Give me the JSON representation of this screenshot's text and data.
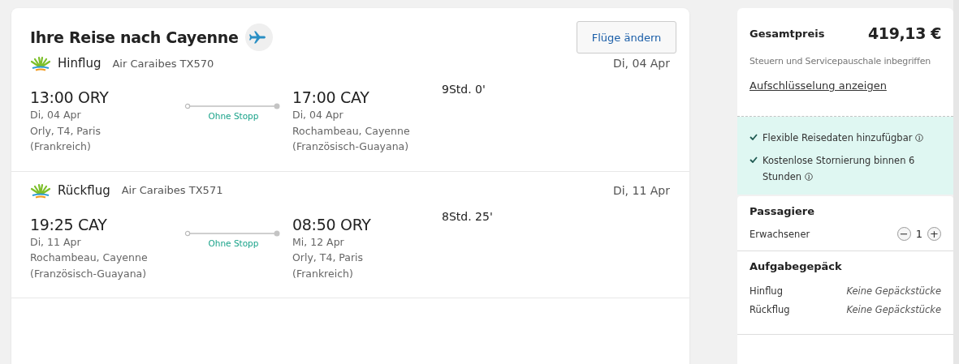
{
  "trip": {
    "title": "Ihre Reise nach Cayenne",
    "change_button": "Flüge ändern",
    "legs": [
      {
        "label": "Hinflug",
        "flight": "Air Caraibes TX570",
        "date": "Di, 04 Apr",
        "stops": "Ohne Stopp",
        "duration": "9Std. 0'",
        "departure": {
          "time": "13:00 ORY",
          "date": "Di, 04 Apr",
          "airport": "Orly, T4, Paris",
          "country": "(Frankreich)"
        },
        "arrival": {
          "time": "17:00 CAY",
          "date": "Di, 04 Apr",
          "airport": "Rochambeau, Cayenne",
          "country": "(Französisch-Guayana)"
        }
      },
      {
        "label": "Rückflug",
        "flight": "Air Caraibes TX571",
        "date": "Di, 11 Apr",
        "stops": "Ohne Stopp",
        "duration": "8Std. 25'",
        "departure": {
          "time": "19:25 CAY",
          "date": "Di, 11 Apr",
          "airport": "Rochambeau, Cayenne",
          "country": "(Französisch-Guayana)"
        },
        "arrival": {
          "time": "08:50 ORY",
          "date": "Mi, 12 Apr",
          "airport": "Orly, T4, Paris",
          "country": "(Frankreich)"
        }
      }
    ]
  },
  "summary": {
    "price_label": "Gesamtpreis",
    "price": "419,13 €",
    "note": "Steuern und Servicepauschale inbegriffen",
    "breakdown_link": "Aufschlüsselung anzeigen",
    "benefits": [
      "Flexible Reisedaten hinzufügbar",
      "Kostenlose Stornierung binnen 6 Stunden"
    ],
    "passengers": {
      "title": "Passagiere",
      "label": "Erwachsener",
      "minus": "−",
      "count": "1",
      "plus": "+"
    },
    "baggage": {
      "title": "Aufgabegepäck",
      "rows": [
        {
          "leg": "Hinflug",
          "value": "Keine Gepäckstücke"
        },
        {
          "leg": "Rückflug",
          "value": "Keine Gepäckstücke"
        }
      ]
    }
  }
}
